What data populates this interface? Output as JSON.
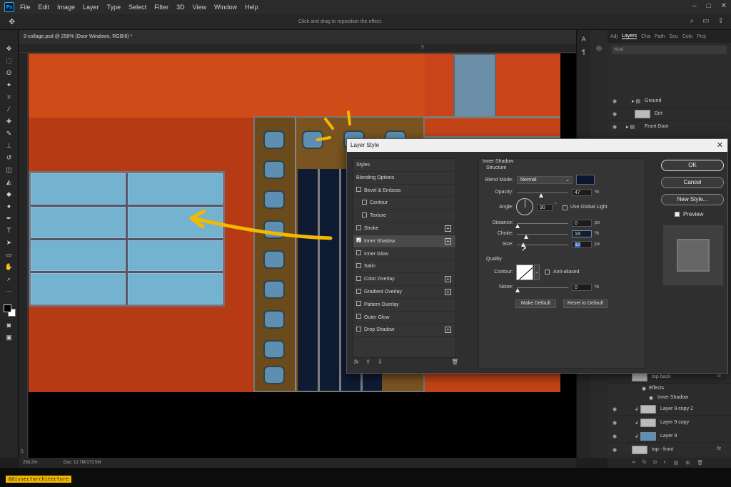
{
  "menu": {
    "items": [
      "File",
      "Edit",
      "Image",
      "Layer",
      "Type",
      "Select",
      "Filter",
      "3D",
      "View",
      "Window",
      "Help"
    ],
    "logo": "Ps"
  },
  "options": {
    "hint": "Click and drag to reposition the effect."
  },
  "document": {
    "tab_title": "2-collage.psd @ 258% (Door Windows, RGB/8) *",
    "ruler_top": [
      "5"
    ],
    "ruler_left": [
      "5"
    ]
  },
  "status": {
    "zoom": "258.2%",
    "doc": "Doc: 12.7M/173.5M"
  },
  "watermark": "@dissectarchitecture",
  "right_strip": [
    "A",
    "¶"
  ],
  "layers_panel": {
    "tabs": [
      "Adj",
      "Layers",
      "Cha",
      "Path",
      "Sou",
      "Colo",
      "Proj"
    ],
    "search": "Kind",
    "rows_top": [
      {
        "name": "Ground",
        "indent": 1,
        "folder": true
      },
      {
        "name": "Dirt",
        "indent": 2,
        "folder": false
      },
      {
        "name": "Front Door",
        "indent": 1,
        "folder": true
      }
    ],
    "rows_bottom": [
      {
        "name": "top back",
        "fx": "fx"
      },
      {
        "name": "Effects"
      },
      {
        "name": "Inner Shadow"
      },
      {
        "name": "Layer 9 copy 2"
      },
      {
        "name": "Layer 9 copy"
      },
      {
        "name": "Layer 9"
      },
      {
        "name": "top - front",
        "fx": "fx"
      }
    ]
  },
  "dialog": {
    "title": "Layer Style",
    "styles": [
      {
        "label": "Styles",
        "checkbox": false,
        "checked": false,
        "plus": false,
        "selected": false,
        "indent": false
      },
      {
        "label": "Blending Options",
        "checkbox": false,
        "checked": false,
        "plus": false,
        "selected": false,
        "indent": false
      },
      {
        "label": "Bevel & Emboss",
        "checkbox": true,
        "checked": false,
        "plus": false,
        "selected": false,
        "indent": false
      },
      {
        "label": "Contour",
        "checkbox": true,
        "checked": false,
        "plus": false,
        "selected": false,
        "indent": true
      },
      {
        "label": "Texture",
        "checkbox": true,
        "checked": false,
        "plus": false,
        "selected": false,
        "indent": true
      },
      {
        "label": "Stroke",
        "checkbox": true,
        "checked": false,
        "plus": true,
        "selected": false,
        "indent": false
      },
      {
        "label": "Inner Shadow",
        "checkbox": true,
        "checked": true,
        "plus": true,
        "selected": true,
        "indent": false
      },
      {
        "label": "Inner Glow",
        "checkbox": true,
        "checked": false,
        "plus": false,
        "selected": false,
        "indent": false
      },
      {
        "label": "Satin",
        "checkbox": true,
        "checked": false,
        "plus": false,
        "selected": false,
        "indent": false
      },
      {
        "label": "Color Overlay",
        "checkbox": true,
        "checked": false,
        "plus": true,
        "selected": false,
        "indent": false
      },
      {
        "label": "Gradient Overlay",
        "checkbox": true,
        "checked": false,
        "plus": true,
        "selected": false,
        "indent": false
      },
      {
        "label": "Pattern Overlay",
        "checkbox": true,
        "checked": false,
        "plus": false,
        "selected": false,
        "indent": false
      },
      {
        "label": "Outer Glow",
        "checkbox": true,
        "checked": false,
        "plus": false,
        "selected": false,
        "indent": false
      },
      {
        "label": "Drop Shadow",
        "checkbox": true,
        "checked": false,
        "plus": true,
        "selected": false,
        "indent": false
      }
    ],
    "footer": {
      "fx": "fx",
      "up": "⇧",
      "down": "⇩",
      "trash": "🗑"
    },
    "inner_shadow": {
      "title": "Inner Shadow",
      "structure": "Structure",
      "blend_mode_label": "Blend Mode:",
      "blend_mode": "Normal",
      "shadow_color": "#0c1633",
      "opacity_label": "Opacity:",
      "opacity": "47",
      "opacity_unit": "%",
      "angle_label": "Angle:",
      "angle": "90",
      "angle_unit": "°",
      "global_light": "Use Global Light",
      "distance_label": "Distance:",
      "distance": "0",
      "distance_unit": "px",
      "choke_label": "Choke:",
      "choke": "18",
      "choke_unit": "%",
      "size_label": "Size:",
      "size": "10",
      "size_unit": "px",
      "quality": "Quality",
      "contour_label": "Contour:",
      "anti_aliased": "Anti-aliased",
      "noise_label": "Noise:",
      "noise": "0",
      "noise_unit": "%",
      "make_default": "Make Default",
      "reset_default": "Reset to Default"
    },
    "buttons": {
      "ok": "OK",
      "cancel": "Cancel",
      "new_style": "New Style..."
    },
    "preview_label": "Preview"
  }
}
